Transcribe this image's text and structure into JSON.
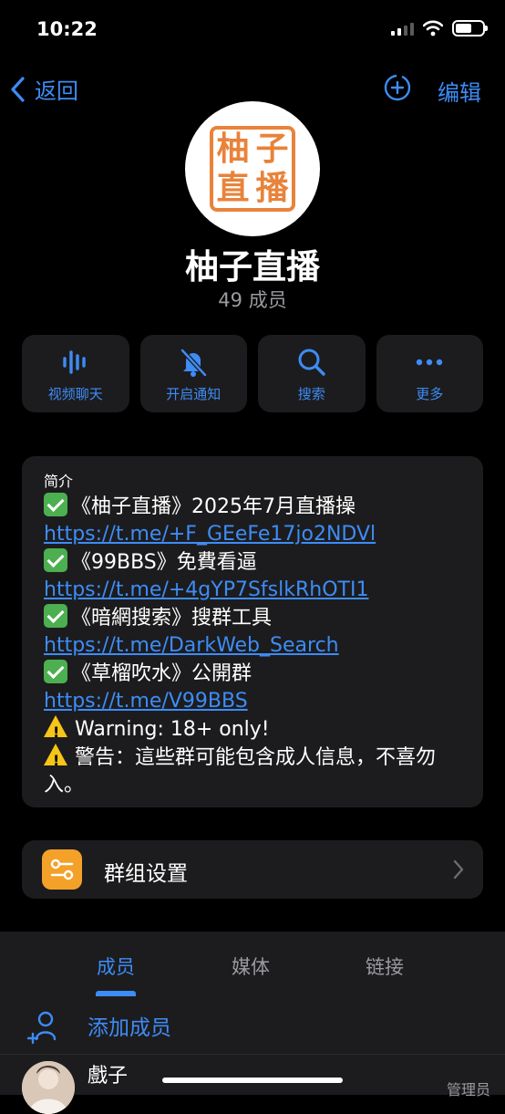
{
  "status_bar": {
    "time": "10:22",
    "battery_level": 0.6
  },
  "nav": {
    "back_label": "返回",
    "edit_label": "编辑",
    "add_icon": "add-circle-icon"
  },
  "group": {
    "logo_chars": [
      "柚",
      "子",
      "直",
      "播"
    ],
    "name": "柚子直播",
    "member_count": "49 成员"
  },
  "actions": [
    {
      "label": "视频聊天",
      "icon": "voice-wave-icon"
    },
    {
      "label": "开启通知",
      "icon": "bell-muted-icon"
    },
    {
      "label": "搜索",
      "icon": "search-icon"
    },
    {
      "label": "更多",
      "icon": "more-icon"
    }
  ],
  "intro": {
    "title": "简介",
    "items": [
      {
        "text": "《柚子直播》2025年7月直播操",
        "link": "https://t.me/+F_GEeFe17jo2NDVl"
      },
      {
        "text": "《99BBS》免費看逼",
        "link": "https://t.me/+4gYP7SfslkRhOTI1"
      },
      {
        "text": "《暗網搜索》搜群工具",
        "link": "https://t.me/DarkWeb_Search"
      },
      {
        "text": "《草榴吹水》公開群",
        "link": "https://t.me/V99BBS"
      }
    ],
    "warning_en": "Warning: 18+ only!",
    "warning_zh": "警告：這些群可能包含成人信息，不喜勿入。"
  },
  "settings": {
    "label": "群组设置",
    "icon": "settings-sliders-icon"
  },
  "tabs": [
    {
      "label": "成员",
      "active": true
    },
    {
      "label": "媒体",
      "active": false
    },
    {
      "label": "链接",
      "active": false
    }
  ],
  "add_member_label": "添加成员",
  "members": [
    {
      "name": "戲子",
      "role": "管理员"
    }
  ],
  "colors": {
    "accent": "#3e8cf5",
    "card": "#1c1c1e",
    "logo": "#e8833a",
    "settings_icon": "#f4a12a"
  }
}
